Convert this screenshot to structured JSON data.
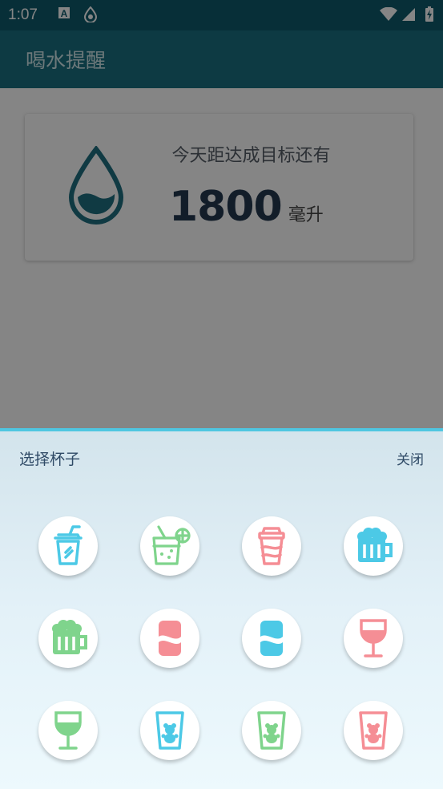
{
  "status_bar": {
    "time": "1:07"
  },
  "app_bar": {
    "title": "喝水提醒"
  },
  "card": {
    "remaining_label": "今天距达成目标还有",
    "remaining_amount": "1800",
    "unit": "毫升"
  },
  "sheet": {
    "title": "选择杯子",
    "close_label": "关闭",
    "cups": [
      {
        "icon": "plastic-cup-icon",
        "color": "#4cc9e6"
      },
      {
        "icon": "lemonade-icon",
        "color": "#7fd48c"
      },
      {
        "icon": "coffee-cup-icon",
        "color": "#f58e95"
      },
      {
        "icon": "beer-mug-icon",
        "color": "#4cc9e6"
      },
      {
        "icon": "beer-mug-icon",
        "color": "#7fd48c"
      },
      {
        "icon": "soda-can-icon",
        "color": "#f58e95"
      },
      {
        "icon": "soda-can-icon",
        "color": "#4cc9e6"
      },
      {
        "icon": "wine-glass-icon",
        "color": "#f58e95"
      },
      {
        "icon": "wine-glass-icon",
        "color": "#7fd48c"
      },
      {
        "icon": "bear-glass-icon",
        "color": "#4cc9e6"
      },
      {
        "icon": "bear-glass-icon",
        "color": "#7fd48c"
      },
      {
        "icon": "bear-glass-icon",
        "color": "#f58e95"
      }
    ]
  },
  "colors": {
    "primary_dark": "#0f5b6b",
    "primary": "#1a6f80",
    "accent": "#4fc6e1",
    "text_dark": "#2f4a66"
  }
}
